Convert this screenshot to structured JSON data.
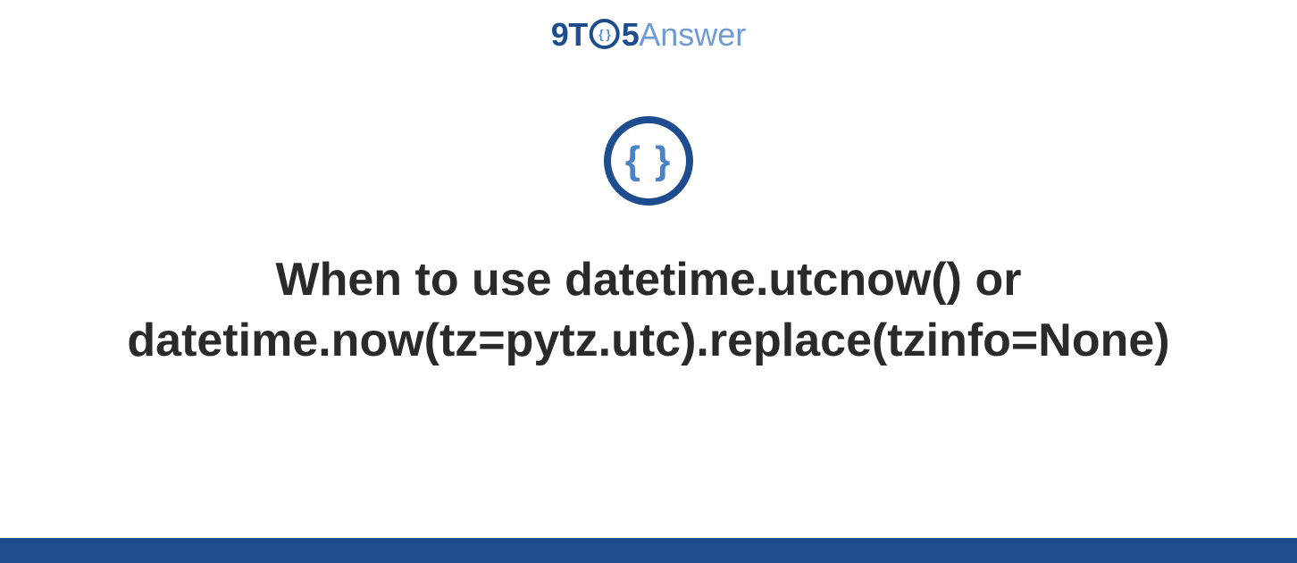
{
  "logo": {
    "prefix9T": "9T",
    "braces_small": "{ }",
    "five": "5",
    "answer": "Answer"
  },
  "hero_icon": "{ }",
  "headline": "When to use datetime.utcnow() or datetime.now(tz=pytz.utc).replace(tzinfo=None)",
  "colors": {
    "primary": "#1d4c8f",
    "accent": "#4a82c6",
    "light_accent": "#6f9ad4",
    "bg": "#ffffff",
    "text": "#2a2a2a"
  }
}
